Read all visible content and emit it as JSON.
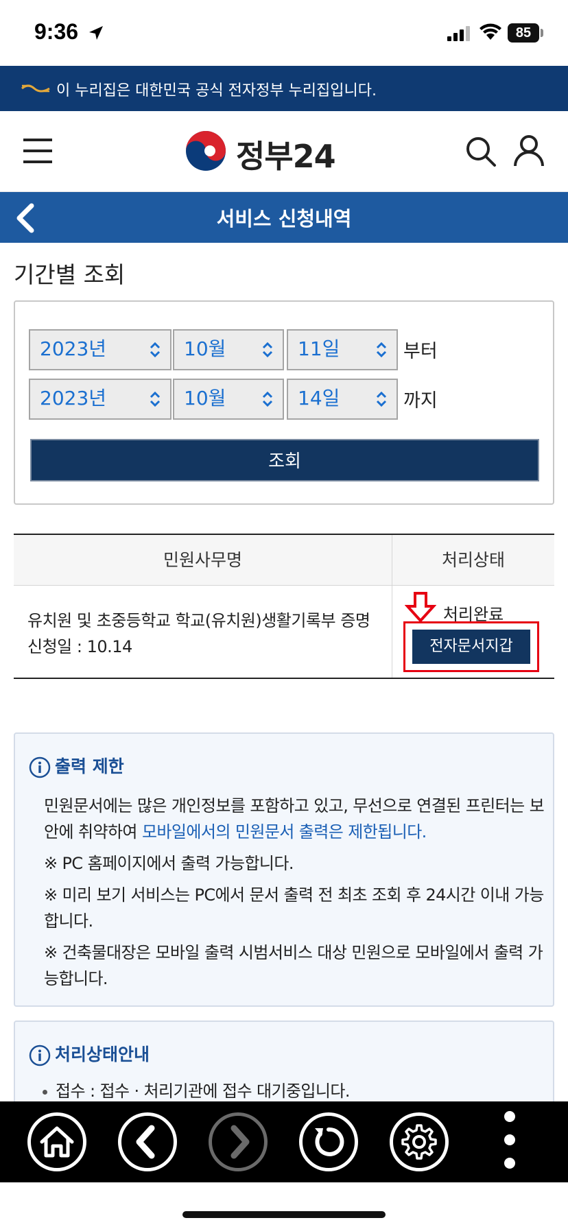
{
  "status_bar": {
    "time": "9:36",
    "battery": "85",
    "icons": [
      "location-arrow-icon",
      "cellular-signal-icon",
      "wifi-icon",
      "battery-icon"
    ]
  },
  "gov_banner": {
    "text": "이 누리집은 대한민국 공식 전자정부 누리집입니다.",
    "icon": "gov-emblem-icon"
  },
  "header": {
    "logo_text": "정부24",
    "icons": [
      "menu-icon",
      "search-icon",
      "user-icon"
    ]
  },
  "title_bar": {
    "title": "서비스 신청내역",
    "back_icon": "chevron-left-icon"
  },
  "filter": {
    "section_title": "기간별 조회",
    "from": {
      "year": "2023년",
      "month": "10월",
      "day": "11일",
      "suffix": "부터"
    },
    "to": {
      "year": "2023년",
      "month": "10월",
      "day": "14일",
      "suffix": "까지"
    },
    "search_button": "조회"
  },
  "table": {
    "headers": [
      "민원사무명",
      "처리상태"
    ],
    "rows": [
      {
        "name": "유치원 및 초중등학교 학교(유치원)생활기록부 증명",
        "date": "신청일 : 10.14",
        "status": "처리완료",
        "action": "전자문서지갑"
      }
    ]
  },
  "info_print": {
    "title": "출력 제한",
    "p1_a": "민원문서에는 많은 개인정보를 포함하고 있고, 무선으로 연결된 프린터는 보안에 취약하여 ",
    "p1_b": "모바일에서의 민원문서 출력은 제한됩니다.",
    "p2": "※ PC 홈페이지에서 출력 가능합니다.",
    "p3": "※ 미리 보기 서비스는 PC에서 문서 출력 전 최초 조회 후 24시간 이내 가능합니다.",
    "p4": "※ 건축물대장은 모바일 출력 시범서비스 대상 민원으로 모바일에서 출력 가능합니다."
  },
  "info_status": {
    "title": "처리상태안내",
    "item1": "접수 : 접수 · 처리기관에 접수 대기중입니다."
  },
  "toolbar": {
    "buttons": [
      "home-icon",
      "back-arrow-icon",
      "forward-arrow-icon",
      "reload-icon",
      "settings-icon",
      "more-icon"
    ]
  },
  "colors": {
    "gov_banner": "#0f3a72",
    "title_bar": "#1e5aa0",
    "primary_button": "#12355f",
    "select_text": "#1a6fd0",
    "highlight": "#e60012"
  }
}
